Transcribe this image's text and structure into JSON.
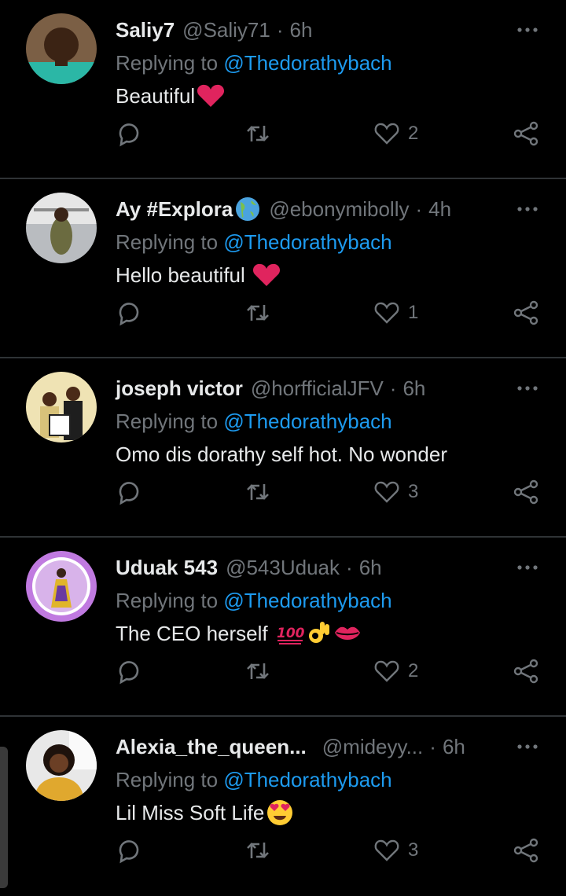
{
  "tweets": [
    {
      "name": "Saliy7",
      "handle": "@Saliy71",
      "time": "6h",
      "replying_prefix": "Replying to",
      "mention": "@Thedorathybach",
      "text": "Beautiful",
      "emojis": [
        "red-heart"
      ],
      "likes": "2",
      "avatar_colors": [
        "#5a3a1e",
        "#2bb7a6"
      ]
    },
    {
      "name": "Ay #Explora",
      "handle": "@ebonymibolly",
      "time": "4h",
      "replying_prefix": "Replying to",
      "mention": "@Thedorathybach",
      "text": "Hello beautiful ",
      "emojis": [
        "red-heart"
      ],
      "likes": "1",
      "avatar_colors": [
        "#8a8f96",
        "#c9c9c9"
      ]
    },
    {
      "name": "joseph victor",
      "handle": "@horfficialJFV",
      "time": "6h",
      "replying_prefix": "Replying to",
      "mention": "@Thedorathybach",
      "text": "Omo dis dorathy self hot. No wonder",
      "emojis": [],
      "likes": "3",
      "avatar_colors": [
        "#e8d9a8",
        "#2b2b2b"
      ]
    },
    {
      "name": "Uduak 543",
      "handle": "@543Uduak",
      "time": "6h",
      "replying_prefix": "Replying to",
      "mention": "@Thedorathybach",
      "text": "The CEO herself ",
      "emojis": [
        "hundred",
        "ok-hand",
        "kiss-mark"
      ],
      "likes": "2",
      "avatar_colors": [
        "#b06ad6",
        "#ffffff"
      ]
    },
    {
      "name": "Alexia_the_queen...",
      "handle": "@mideyy...",
      "time": "6h",
      "replying_prefix": "Replying to",
      "mention": "@Thedorathybach",
      "text": "Lil Miss Soft Life",
      "emojis": [
        "heart-eyes"
      ],
      "likes": "3",
      "avatar_colors": [
        "#e0a82e",
        "#3a2a1e"
      ]
    }
  ],
  "icons": {
    "reply": "reply-icon",
    "retweet": "retweet-icon",
    "like": "heart-icon",
    "share": "share-icon",
    "more": "more-icon"
  },
  "colors": {
    "background": "#000000",
    "text": "#e7e9ea",
    "muted": "#71767b",
    "accent": "#1d9bf0",
    "divider": "#2f3336"
  }
}
